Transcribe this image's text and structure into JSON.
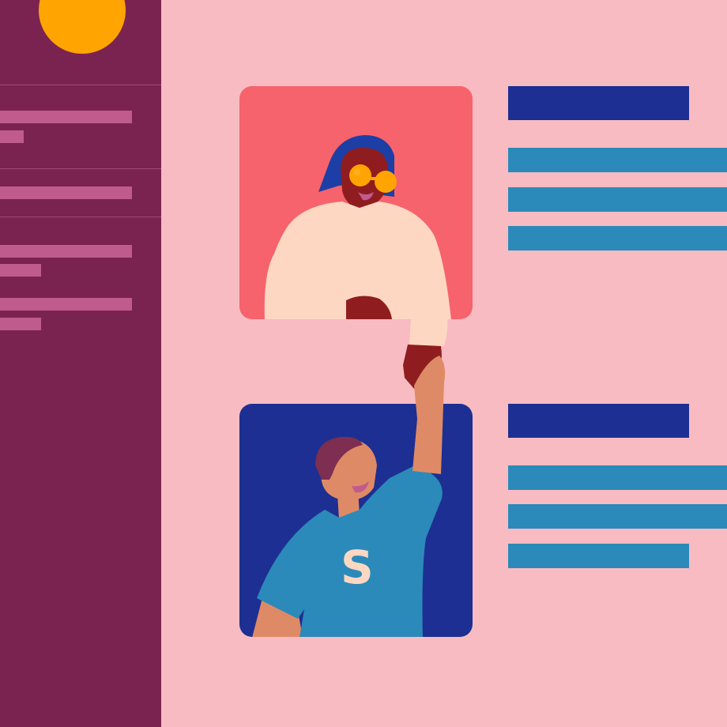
{
  "colors": {
    "sidebar_bg": "#7b2350",
    "sidebar_bar": "#c05b8e",
    "sidebar_divider": "#a3467a",
    "avatar_circle": "#ffa400",
    "main_bg": "#f8bbc2",
    "title_bar": "#1d2f92",
    "text_bar": "#2b8ab9",
    "card_top_bg": "#f6636c",
    "card_bottom_bg": "#1d2f92",
    "skin_dark": "#8f1d1f",
    "skin_light": "#df8a66",
    "hair_blue": "#1d3ea5",
    "hair_plum": "#7d2e51",
    "sweater": "#fed7c2",
    "glasses": "#ffa400",
    "shirt": "#2b8ab9",
    "letter": "#fed7c2",
    "mouth": "#c05b8e"
  },
  "sidebar": {
    "avatar_icon": "user-avatar-circle",
    "groups": [
      {
        "bar_count": 2
      },
      {
        "bar_count": 1
      },
      {
        "bar_count": 4
      }
    ]
  },
  "cards": [
    {
      "figure": "woman-with-round-glasses",
      "bars": {
        "title": 1,
        "lines": 3
      }
    },
    {
      "figure": "man-with-s-shirt",
      "shirt_letter": "S",
      "bars": {
        "title": 1,
        "lines": 3
      }
    }
  ],
  "scene": {
    "icon": "handshake-icon"
  }
}
